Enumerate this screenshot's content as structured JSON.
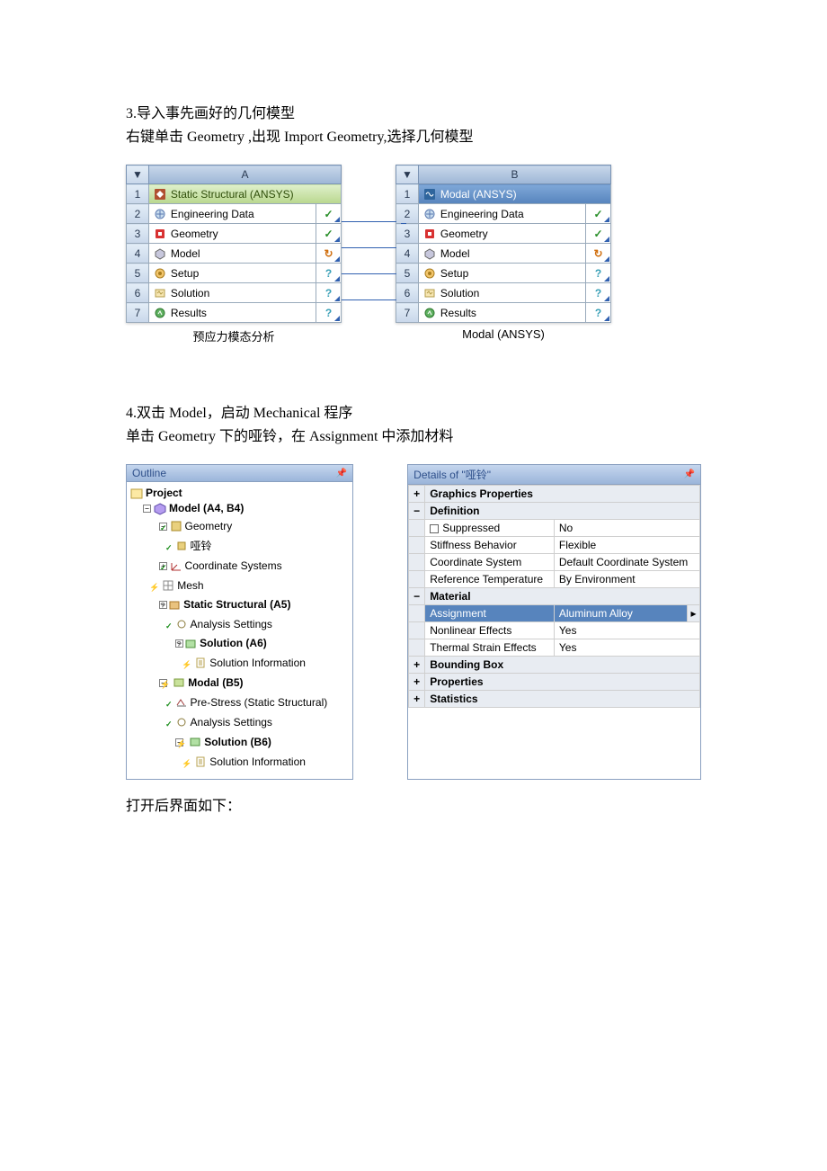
{
  "step3": "3.导入事先画好的几何模型",
  "instr3": "右键单击 Geometry ,出现 Import Geometry,选择几何模型",
  "schematic": {
    "columnA": {
      "header": "A",
      "sysHeader": "Static Structural (ANSYS)",
      "rows": [
        {
          "n": "2",
          "label": "Engineering Data",
          "status": "check"
        },
        {
          "n": "3",
          "label": "Geometry",
          "status": "check"
        },
        {
          "n": "4",
          "label": "Model",
          "status": "refresh"
        },
        {
          "n": "5",
          "label": "Setup",
          "status": "question"
        },
        {
          "n": "6",
          "label": "Solution",
          "status": "question"
        },
        {
          "n": "7",
          "label": "Results",
          "status": "question"
        }
      ],
      "caption": "预应力模态分析"
    },
    "columnB": {
      "header": "B",
      "sysHeader": "Modal (ANSYS)",
      "rows": [
        {
          "n": "2",
          "label": "Engineering Data",
          "status": "check"
        },
        {
          "n": "3",
          "label": "Geometry",
          "status": "check"
        },
        {
          "n": "4",
          "label": "Model",
          "status": "refresh"
        },
        {
          "n": "5",
          "label": "Setup",
          "status": "question"
        },
        {
          "n": "6",
          "label": "Solution",
          "status": "question"
        },
        {
          "n": "7",
          "label": "Results",
          "status": "question"
        }
      ],
      "caption": "Modal (ANSYS)"
    }
  },
  "step4": "4.双击 Model，启动 Mechanical  程序",
  "instr4": "单击 Geometry  下的哑铃，在 Assignment 中添加材料",
  "outline": {
    "title": "Outline",
    "project": "Project",
    "model": "Model (A4, B4)",
    "geometry": "Geometry",
    "dumbbell": "哑铃",
    "coord": "Coordinate Systems",
    "mesh": "Mesh",
    "static": "Static Structural (A5)",
    "anset1": "Analysis Settings",
    "solA6": "Solution (A6)",
    "solinfo1": "Solution Information",
    "modal": "Modal (B5)",
    "prestress": "Pre-Stress (Static Structural)",
    "anset2": "Analysis Settings",
    "solB6": "Solution (B6)",
    "solinfo2": "Solution Information"
  },
  "details": {
    "title": "Details of \"哑铃\"",
    "groups": {
      "graphics": "Graphics Properties",
      "definition": "Definition",
      "material": "Material",
      "Bounding Box": "Bounding Box",
      "Properties": "Properties",
      "Statistics": "Statistics"
    },
    "definitionRows": [
      {
        "label": "Suppressed",
        "value": "No",
        "checkbox": true
      },
      {
        "label": "Stiffness Behavior",
        "value": "Flexible"
      },
      {
        "label": "Coordinate System",
        "value": "Default Coordinate System"
      },
      {
        "label": "Reference Temperature",
        "value": "By Environment"
      }
    ],
    "materialRows": [
      {
        "label": "Assignment",
        "value": "Aluminum Alloy",
        "highlight": true,
        "arrow": true
      },
      {
        "label": "Nonlinear Effects",
        "value": "Yes"
      },
      {
        "label": "Thermal Strain Effects",
        "value": "Yes"
      }
    ]
  },
  "after_open": "打开后界面如下："
}
